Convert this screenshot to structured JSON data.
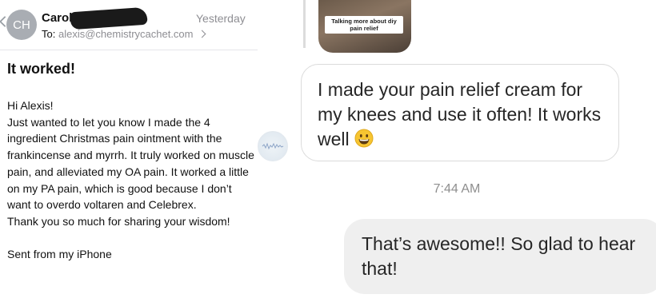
{
  "email": {
    "avatar_initials": "CH",
    "sender": "Carole Henry",
    "date": "Yesterday",
    "to_label": "To:",
    "to_address": "alexis@chemistrycachet.com",
    "subject": "It worked!",
    "body_lines": [
      "Hi Alexis!",
      "Just wanted to let you know I made the 4 ingredient Christmas pain ointment with the frankincense and myrrh. It truly worked on muscle pain, and alleviated my OA pain. It worked a little on my PA pain, which is good because I don’t want to overdo voltaren and Celebrex.",
      "Thank you so much for sharing your wisdom!",
      "",
      "Sent from my iPhone"
    ]
  },
  "chat": {
    "story_caption": "Talking more about diy pain relief",
    "incoming_message": "I made your pain relief cream for my knees and use it often! It works well",
    "incoming_emoji": "grinning-face",
    "timestamp": "7:44 AM",
    "outgoing_message": "That’s awesome!! So glad to hear that!"
  },
  "colors": {
    "muted_text": "#8e8e93",
    "bubble_out_bg": "#efefef",
    "bubble_in_border": "#dbdbdb",
    "emoji_yellow": "#f7c531"
  }
}
